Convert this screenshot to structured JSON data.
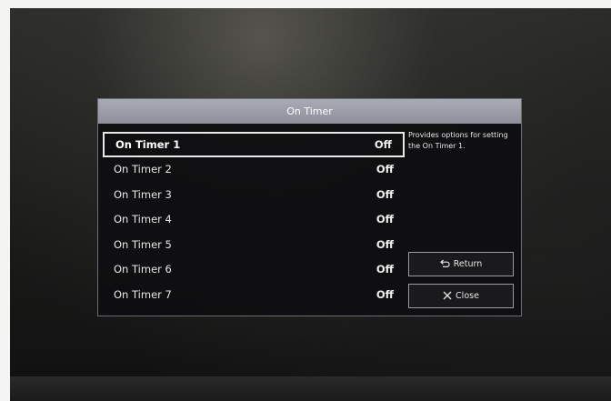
{
  "dialog": {
    "title": "On Timer",
    "description": "Provides options for setting the On Timer 1.",
    "items": [
      {
        "label": "On Timer 1",
        "value": "Off"
      },
      {
        "label": "On Timer 2",
        "value": "Off"
      },
      {
        "label": "On Timer 3",
        "value": "Off"
      },
      {
        "label": "On Timer 4",
        "value": "Off"
      },
      {
        "label": "On Timer 5",
        "value": "Off"
      },
      {
        "label": "On Timer 6",
        "value": "Off"
      },
      {
        "label": "On Timer 7",
        "value": "Off"
      }
    ],
    "selected_index": 0,
    "return_label": "Return",
    "close_label": "Close",
    "return_icon": "return-arrow-icon",
    "close_icon": "close-x-icon"
  },
  "colors": {
    "titlebar": "#9c9fa9",
    "dialog_bg": "#0e0e10",
    "highlight_border": "#e9e9e9",
    "text": "#e6e6e6"
  }
}
